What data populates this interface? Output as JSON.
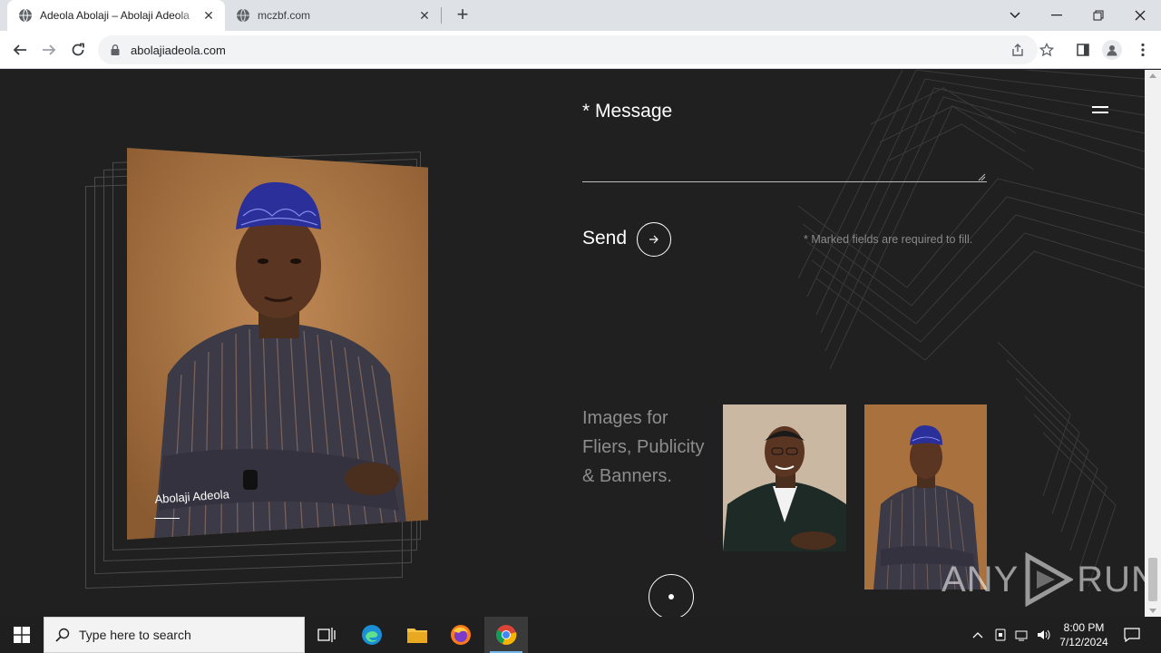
{
  "browser": {
    "tabs": [
      {
        "title": "Adeola Abolaji – Abolaji Adeola",
        "active": true
      },
      {
        "title": "mczbf.com",
        "active": false
      }
    ],
    "url": "abolajiadeola.com"
  },
  "page": {
    "portrait_caption": "Abolaji Adeola",
    "contact_form": {
      "message_label": "* Message",
      "message_value": "",
      "send_label": "Send",
      "required_note": "* Marked fields are required to fill."
    },
    "gallery": {
      "heading_lines": [
        "Images for",
        "Fliers, Publicity",
        "& Banners."
      ]
    },
    "watermark": {
      "left": "ANY",
      "right": "RUN"
    }
  },
  "taskbar": {
    "search_placeholder": "Type here to search",
    "time": "8:00 PM",
    "date": "7/12/2024"
  },
  "colors": {
    "page_bg": "#202020",
    "accent_text": "#ffffff",
    "muted_text": "#8d8d8d",
    "chrome_tabbar": "#dee1e6"
  }
}
